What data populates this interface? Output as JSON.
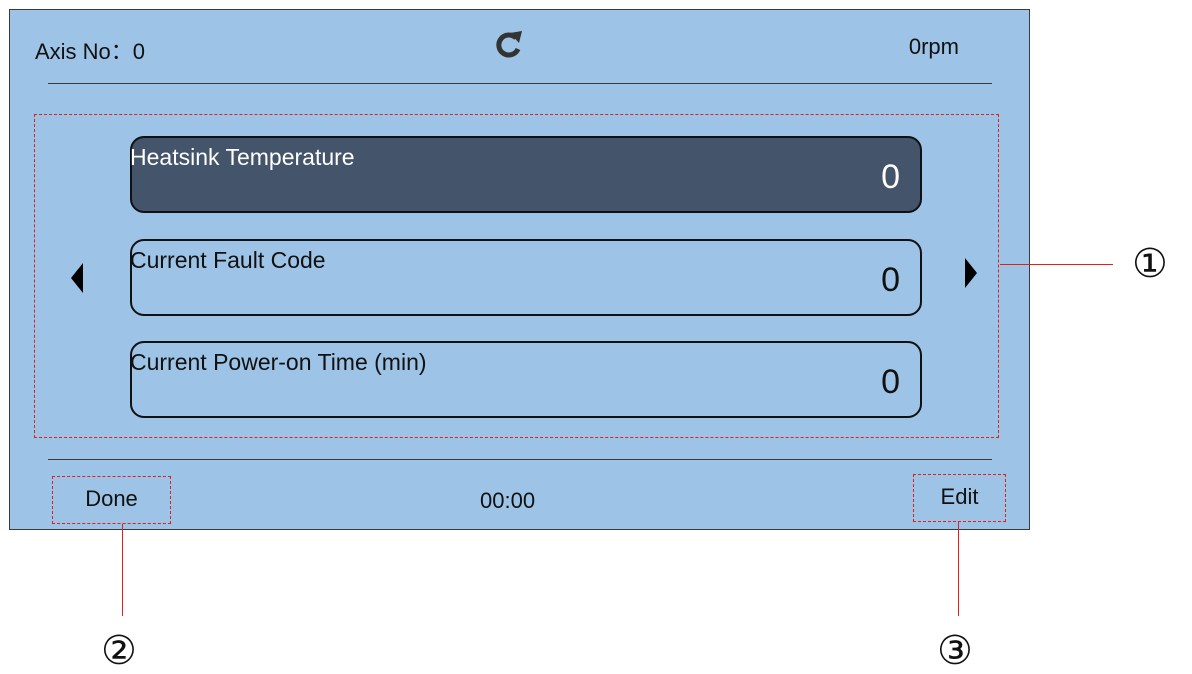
{
  "header": {
    "axis_label": "Axis No：0",
    "speed": "0rpm"
  },
  "list": {
    "items": [
      {
        "label": "Heatsink Temperature",
        "value": "0",
        "selected": true
      },
      {
        "label": "Current Fault Code",
        "value": "0",
        "selected": false
      },
      {
        "label": "Current Power-on Time (min)",
        "value": "0",
        "selected": false
      }
    ]
  },
  "footer": {
    "left_button": "Done",
    "timer": "00:00",
    "right_button": "Edit"
  },
  "callouts": {
    "one": "①",
    "two": "②",
    "three": "③"
  },
  "colors": {
    "screen_bg": "#9dc3e6",
    "selected_item_bg": "#44546a",
    "callout_line": "#e0201b"
  },
  "icons": {
    "refresh": "refresh-icon",
    "page_left": "chevron-left-icon",
    "page_right": "chevron-right-icon"
  }
}
